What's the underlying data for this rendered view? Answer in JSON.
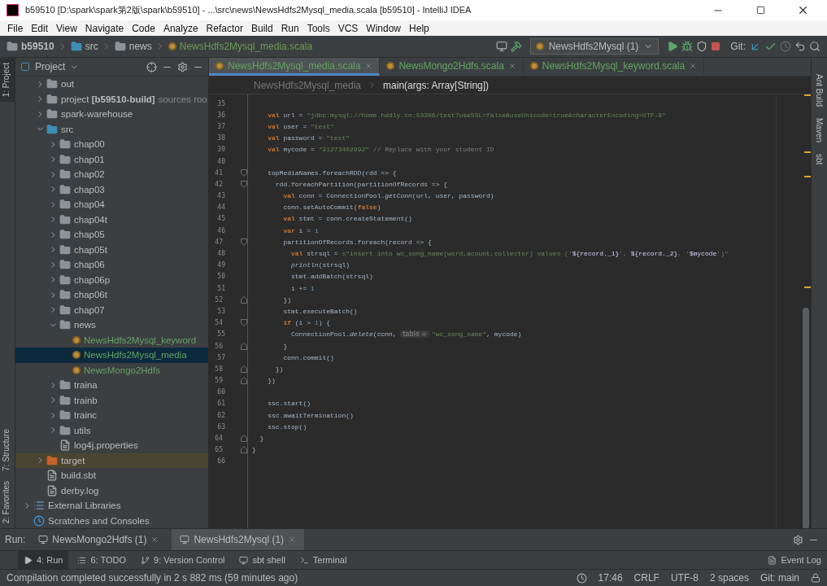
{
  "window": {
    "title": "b59510 [D:\\spark\\spark第2版\\spark\\b59510] - ...\\src\\news\\NewsHdfs2Mysql_media.scala [b59510] - IntelliJ IDEA"
  },
  "menu": [
    "File",
    "Edit",
    "View",
    "Navigate",
    "Code",
    "Analyze",
    "Refactor",
    "Build",
    "Run",
    "Tools",
    "VCS",
    "Window",
    "Help"
  ],
  "nav_path": [
    {
      "label": "b59510",
      "kind": "module"
    },
    {
      "label": "src",
      "kind": "source-folder"
    },
    {
      "label": "news",
      "kind": "package"
    },
    {
      "label": "NewsHdfs2Mysql_media.scala",
      "kind": "scala-file"
    }
  ],
  "run_config": "NewsHdfs2Mysql (1)",
  "git_label": "Git:",
  "left_strip": [
    {
      "label": "1: Project",
      "selected": true
    },
    {
      "label": "7: Structure",
      "selected": false
    },
    {
      "label": "2: Favorites",
      "selected": false
    }
  ],
  "project_panel": {
    "title": "Project",
    "module_children": [
      {
        "label": "out",
        "kind": "folder",
        "expanded": false,
        "selected": false
      },
      {
        "label": "project **[b59510-build]**",
        "note": "sources roo",
        "kind": "module-folder",
        "expanded": false,
        "selected": false
      },
      {
        "label": "spark-warehouse",
        "kind": "folder",
        "expanded": false,
        "selected": false
      },
      {
        "label": "src",
        "kind": "source-folder",
        "expanded": true,
        "selected": false,
        "children": [
          {
            "label": "chap00",
            "kind": "package",
            "expanded": false,
            "selected": false
          },
          {
            "label": "chap01",
            "kind": "package",
            "expanded": false,
            "selected": false
          },
          {
            "label": "chap02",
            "kind": "package",
            "expanded": false,
            "selected": false
          },
          {
            "label": "chap03",
            "kind": "package",
            "expanded": false,
            "selected": false
          },
          {
            "label": "chap04",
            "kind": "package",
            "expanded": false,
            "selected": false
          },
          {
            "label": "chap04t",
            "kind": "package",
            "expanded": false,
            "selected": false
          },
          {
            "label": "chap05",
            "kind": "package",
            "expanded": false,
            "selected": false
          },
          {
            "label": "chap05t",
            "kind": "package",
            "expanded": false,
            "selected": false
          },
          {
            "label": "chap06",
            "kind": "package",
            "expanded": false,
            "selected": false
          },
          {
            "label": "chap06p",
            "kind": "package",
            "expanded": false,
            "selected": false
          },
          {
            "label": "chap06t",
            "kind": "package",
            "expanded": false,
            "selected": false
          },
          {
            "label": "chap07",
            "kind": "package",
            "expanded": false,
            "selected": false
          },
          {
            "label": "news",
            "kind": "package",
            "expanded": true,
            "selected": false,
            "children": [
              {
                "label": "NewsHdfs2Mysql_keyword",
                "kind": "scala-file",
                "selected": false
              },
              {
                "label": "NewsHdfs2Mysql_media",
                "kind": "scala-file",
                "selected": true
              },
              {
                "label": "NewsMongo2Hdfs",
                "kind": "scala-file",
                "selected": false
              }
            ]
          },
          {
            "label": "traina",
            "kind": "package",
            "expanded": false,
            "selected": false
          },
          {
            "label": "trainb",
            "kind": "package",
            "expanded": false,
            "selected": false
          },
          {
            "label": "trainc",
            "kind": "package",
            "expanded": false,
            "selected": false
          },
          {
            "label": "utils",
            "kind": "package",
            "expanded": false,
            "selected": false
          },
          {
            "label": "log4j.properties",
            "kind": "properties-file",
            "selected": false
          }
        ]
      },
      {
        "label": "target",
        "kind": "excluded-folder",
        "expanded": false,
        "selected": false
      },
      {
        "label": "build.sbt",
        "kind": "sbt-file",
        "selected": false
      },
      {
        "label": "derby.log",
        "kind": "log-file",
        "selected": false
      }
    ],
    "items": [
      {
        "label": "External Libraries",
        "kind": "libraries",
        "expanded": false,
        "selected": false
      },
      {
        "label": "Scratches and Consoles",
        "kind": "scratches",
        "selected": false
      }
    ]
  },
  "editor": {
    "tabs": [
      {
        "label": "NewsHdfs2Mysql_media.scala",
        "selected": true
      },
      {
        "label": "NewsMongo2Hdfs.scala",
        "selected": false
      },
      {
        "label": "NewsHdfs2Mysql_keyword.scala",
        "selected": false
      }
    ],
    "breadcrumb": [
      "NewsHdfs2Mysql_media",
      "main(args: Array[String])"
    ],
    "lines": [
      {
        "number": "35"
      },
      {
        "number": "36",
        "tokens": [
          {
            "kind": "keyword",
            "text": "    val"
          },
          {
            "kind": "plain",
            "text": " url = "
          },
          {
            "kind": "string",
            "text": "\"jdbc:mysql://home.hddly.cn:53306/test?useSSL=false&useUnicode=true&characterEncoding=UTF-8\""
          }
        ]
      },
      {
        "number": "37",
        "tokens": [
          {
            "kind": "keyword",
            "text": "    val"
          },
          {
            "kind": "plain",
            "text": " user = "
          },
          {
            "kind": "string",
            "text": "\"test\""
          }
        ]
      },
      {
        "number": "38",
        "tokens": [
          {
            "kind": "keyword",
            "text": "    val"
          },
          {
            "kind": "plain",
            "text": " password = "
          },
          {
            "kind": "string",
            "text": "\"test\""
          }
        ]
      },
      {
        "number": "39",
        "tokens": [
          {
            "kind": "keyword",
            "text": "    val"
          },
          {
            "kind": "plain",
            "text": " mycode = "
          },
          {
            "kind": "string",
            "text": "\"21273402092\""
          },
          {
            "kind": "comment",
            "text": " // Replace with your student ID"
          }
        ]
      },
      {
        "number": "40"
      },
      {
        "number": "41",
        "fold_start": true,
        "tokens": [
          {
            "kind": "plain",
            "text": "    topMediaNames.foreachRDD(rdd => {"
          }
        ]
      },
      {
        "number": "42",
        "fold_start": true,
        "tokens": [
          {
            "kind": "plain",
            "text": "      rdd.foreachPartition(partitionOfRecords => {"
          }
        ]
      },
      {
        "number": "43",
        "tokens": [
          {
            "kind": "keyword",
            "text": "        val"
          },
          {
            "kind": "plain",
            "text": " conn = ConnectionPool."
          },
          {
            "kind": "italic",
            "text": "getConn"
          },
          {
            "kind": "plain",
            "text": "(url, user, password)"
          }
        ]
      },
      {
        "number": "44",
        "tokens": [
          {
            "kind": "plain",
            "text": "        conn.setAutoCommit("
          },
          {
            "kind": "keyword",
            "text": "false"
          },
          {
            "kind": "plain",
            "text": ")"
          }
        ]
      },
      {
        "number": "45",
        "tokens": [
          {
            "kind": "keyword",
            "text": "        val"
          },
          {
            "kind": "plain",
            "text": " stmt = conn.createStatement()"
          }
        ]
      },
      {
        "number": "46",
        "tokens": [
          {
            "kind": "keyword",
            "text": "        var"
          },
          {
            "kind": "plain",
            "text": " i = "
          },
          {
            "kind": "number",
            "text": "1"
          }
        ]
      },
      {
        "number": "47",
        "fold_start": true,
        "tokens": [
          {
            "kind": "plain",
            "text": "        partitionOfRecords.foreach(record => {"
          }
        ]
      },
      {
        "number": "48",
        "tokens": [
          {
            "kind": "keyword",
            "text": "          val"
          },
          {
            "kind": "plain",
            "text": " strsql = "
          },
          {
            "kind": "string",
            "text": "s\"insert into wc_song_name(word,acount,collector) values ('"
          },
          {
            "kind": "interp",
            "text": "${record._1}"
          },
          {
            "kind": "string",
            "text": "', "
          },
          {
            "kind": "interp",
            "text": "${record._2}"
          },
          {
            "kind": "string",
            "text": ", '"
          },
          {
            "kind": "interp",
            "text": "$mycode"
          },
          {
            "kind": "string",
            "text": "')\""
          }
        ]
      },
      {
        "number": "49",
        "tokens": [
          {
            "kind": "italic",
            "text": "          println"
          },
          {
            "kind": "plain",
            "text": "(strsql)"
          }
        ]
      },
      {
        "number": "50",
        "tokens": [
          {
            "kind": "plain",
            "text": "          stmt.addBatch(strsql)"
          }
        ]
      },
      {
        "number": "51",
        "tokens": [
          {
            "kind": "plain",
            "text": "          i += "
          },
          {
            "kind": "number",
            "text": "1"
          }
        ]
      },
      {
        "number": "52",
        "fold_end": true,
        "tokens": [
          {
            "kind": "plain",
            "text": "        })"
          }
        ]
      },
      {
        "number": "53",
        "tokens": [
          {
            "kind": "plain",
            "text": "        stmt.executeBatch()"
          }
        ]
      },
      {
        "number": "54",
        "fold_start": true,
        "tokens": [
          {
            "kind": "keyword",
            "text": "        if"
          },
          {
            "kind": "plain",
            "text": " (i > "
          },
          {
            "kind": "number",
            "text": "1"
          },
          {
            "kind": "plain",
            "text": ") {"
          }
        ]
      },
      {
        "number": "55",
        "tokens": [
          {
            "kind": "plain",
            "text": "          ConnectionPool."
          },
          {
            "kind": "italic",
            "text": "delete"
          },
          {
            "kind": "plain",
            "text": "(conn, "
          },
          {
            "kind": "hint",
            "text": "table ="
          },
          {
            "kind": "string",
            "text": "\"wc_song_name\""
          },
          {
            "kind": "plain",
            "text": ", mycode)"
          }
        ]
      },
      {
        "number": "56",
        "fold_end": true,
        "tokens": [
          {
            "kind": "plain",
            "text": "        }"
          }
        ]
      },
      {
        "number": "57",
        "tokens": [
          {
            "kind": "plain",
            "text": "        conn.commit()"
          }
        ]
      },
      {
        "number": "58",
        "fold_end": true,
        "tokens": [
          {
            "kind": "plain",
            "text": "      })"
          }
        ]
      },
      {
        "number": "59",
        "fold_end": true,
        "tokens": [
          {
            "kind": "plain",
            "text": "    })"
          }
        ]
      },
      {
        "number": "60"
      },
      {
        "number": "61",
        "tokens": [
          {
            "kind": "plain",
            "text": "    ssc.start()"
          }
        ]
      },
      {
        "number": "62",
        "tokens": [
          {
            "kind": "plain",
            "text": "    ssc.awaitTermination()"
          }
        ]
      },
      {
        "number": "63",
        "tokens": [
          {
            "kind": "plain",
            "text": "    ssc.stop()"
          }
        ]
      },
      {
        "number": "64",
        "fold_end": true,
        "tokens": [
          {
            "kind": "plain",
            "text": "  }"
          }
        ]
      },
      {
        "number": "65",
        "fold_end": true,
        "tokens": [
          {
            "kind": "plain",
            "text": "}"
          }
        ]
      },
      {
        "number": "66"
      }
    ]
  },
  "right_strip": [
    "Ant Build",
    "Maven",
    "sbt"
  ],
  "run_panel": {
    "label": "Run:",
    "tabs": [
      {
        "label": "NewsMongo2Hdfs (1)",
        "selected": false
      },
      {
        "label": "NewsHdfs2Mysql (1)",
        "selected": true
      }
    ]
  },
  "tool_buttons": [
    {
      "label": "4: Run",
      "kind": "run",
      "selected": true
    },
    {
      "label": "6: TODO",
      "kind": "todo",
      "selected": false
    },
    {
      "label": "9: Version Control",
      "kind": "vcs",
      "selected": false
    },
    {
      "label": "sbt shell",
      "kind": "sbt",
      "selected": false
    },
    {
      "label": "Terminal",
      "kind": "terminal",
      "selected": false
    },
    {
      "label": "Event Log",
      "kind": "log",
      "selected": false
    }
  ],
  "status_bar": {
    "message": "Compilation completed successfully in 2 s 882 ms (59 minutes ago)",
    "items": [
      "17:46",
      "CRLF",
      "UTF-8",
      "2 spaces",
      "Git: main"
    ]
  }
}
